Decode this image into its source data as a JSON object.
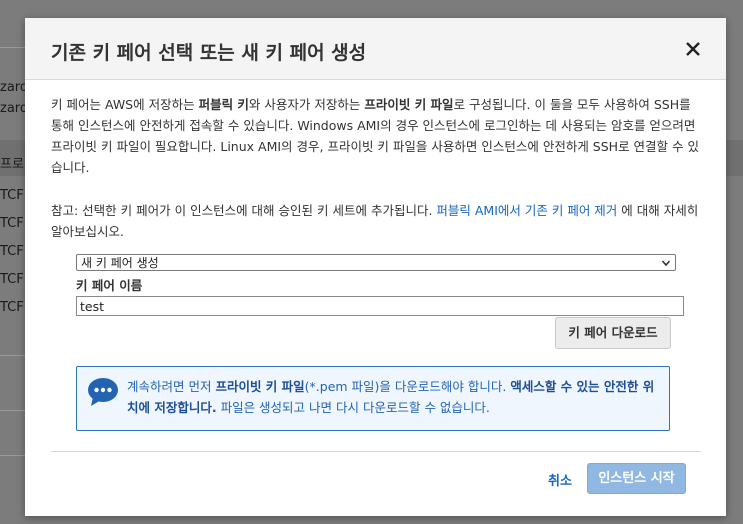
{
  "background": {
    "fragments": [
      "zard",
      "zard",
      "프로",
      "TCF",
      "TCF",
      "TCF",
      "TCF",
      "TCF"
    ]
  },
  "modal": {
    "title": "기존 키 페어 선택 또는 새 키 페어 생성",
    "close_label": "×",
    "intro": {
      "p1_a": "키 페어는 AWS에 저장하는 ",
      "p1_b": "퍼블릭 키",
      "p1_c": "와 사용자가 저장하는 ",
      "p1_d": "프라이빗 키 파일",
      "p1_e": "로 구성됩니다. 이 둘을 모두 사용하여 SSH를 통해 인스턴스에 안전하게 접속할 수 있습니다. Windows AMI의 경우 인스턴스에 로그인하는 데 사용되는 암호를 얻으려면 프라이빗 키 파일이 필요합니다. Linux AMI의 경우, 프라이빗 키 파일을 사용하면 인스턴스에 안전하게 SSH로 연결할 수 있습니다."
    },
    "note": {
      "prefix": "참고: 선택한 키 페어가 이 인스턴스에 대해 승인된 키 세트에 추가됩니다. ",
      "link": "퍼블릭 AMI에서 기존 키 페어 제거",
      "suffix": " 에 대해 자세히 알아보십시오."
    },
    "select": {
      "value": "새 키 페어 생성"
    },
    "key_name": {
      "label": "키 페어 이름",
      "value": "test"
    },
    "download_button": "키 페어 다운로드",
    "info": {
      "a": "계속하려면 먼저 ",
      "b": "프라이빗 키 파일",
      "c": "(*.pem 파일)을 다운로드해야 합니다. ",
      "d": "액세스할 수 있는 안전한 위치에 저장합니다.",
      "e": " 파일은 생성되고 나면 다시 다운로드할 수 없습니다."
    },
    "footer": {
      "cancel": "취소",
      "launch": "인스턴스 시작"
    }
  },
  "colors": {
    "accent": "#1666c0",
    "launch_disabled": "#90b8e3",
    "info_border": "#2f72c0"
  }
}
